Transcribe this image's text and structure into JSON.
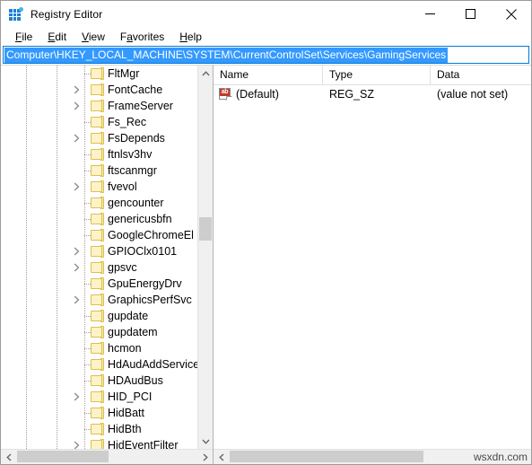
{
  "window": {
    "title": "Registry Editor",
    "icon": "registry-editor-icon",
    "controls": {
      "minimize": "minimize-icon",
      "maximize": "maximize-icon",
      "close": "close-icon"
    }
  },
  "menubar": {
    "items": [
      {
        "label": "File",
        "accel": "F"
      },
      {
        "label": "Edit",
        "accel": "E"
      },
      {
        "label": "View",
        "accel": "V"
      },
      {
        "label": "Favorites",
        "accel": "a"
      },
      {
        "label": "Help",
        "accel": "H"
      }
    ]
  },
  "address": {
    "value": "Computer\\HKEY_LOCAL_MACHINE\\SYSTEM\\CurrentControlSet\\Services\\GamingServices",
    "selected": true,
    "focus_border_color": "#0078d7",
    "selection_color": "#3399ff"
  },
  "tree": {
    "nodes": [
      {
        "label": "FltMgr",
        "expandable": false
      },
      {
        "label": "FontCache",
        "expandable": true
      },
      {
        "label": "FrameServer",
        "expandable": true
      },
      {
        "label": "Fs_Rec",
        "expandable": false
      },
      {
        "label": "FsDepends",
        "expandable": true
      },
      {
        "label": "ftnlsv3hv",
        "expandable": false
      },
      {
        "label": "ftscanmgr",
        "expandable": false
      },
      {
        "label": "fvevol",
        "expandable": true
      },
      {
        "label": "gencounter",
        "expandable": false
      },
      {
        "label": "genericusbfn",
        "expandable": false
      },
      {
        "label": "GoogleChromeEl",
        "expandable": false
      },
      {
        "label": "GPIOClx0101",
        "expandable": true
      },
      {
        "label": "gpsvc",
        "expandable": true
      },
      {
        "label": "GpuEnergyDrv",
        "expandable": false
      },
      {
        "label": "GraphicsPerfSvc",
        "expandable": true
      },
      {
        "label": "gupdate",
        "expandable": false
      },
      {
        "label": "gupdatem",
        "expandable": false
      },
      {
        "label": "hcmon",
        "expandable": false
      },
      {
        "label": "HdAudAddService",
        "expandable": false
      },
      {
        "label": "HDAudBus",
        "expandable": false
      },
      {
        "label": "HID_PCI",
        "expandable": true
      },
      {
        "label": "HidBatt",
        "expandable": false
      },
      {
        "label": "HidBth",
        "expandable": false
      },
      {
        "label": "HidEventFilter",
        "expandable": true
      }
    ],
    "folder_color": "#fdf3c8",
    "folder_border": "#e0bd52"
  },
  "list": {
    "columns": [
      "Name",
      "Type",
      "Data"
    ],
    "rows": [
      {
        "icon": "string-value-icon",
        "name": "(Default)",
        "type": "REG_SZ",
        "data": "(value not set)"
      }
    ]
  },
  "watermark": {
    "text": "wsxdn.com"
  }
}
